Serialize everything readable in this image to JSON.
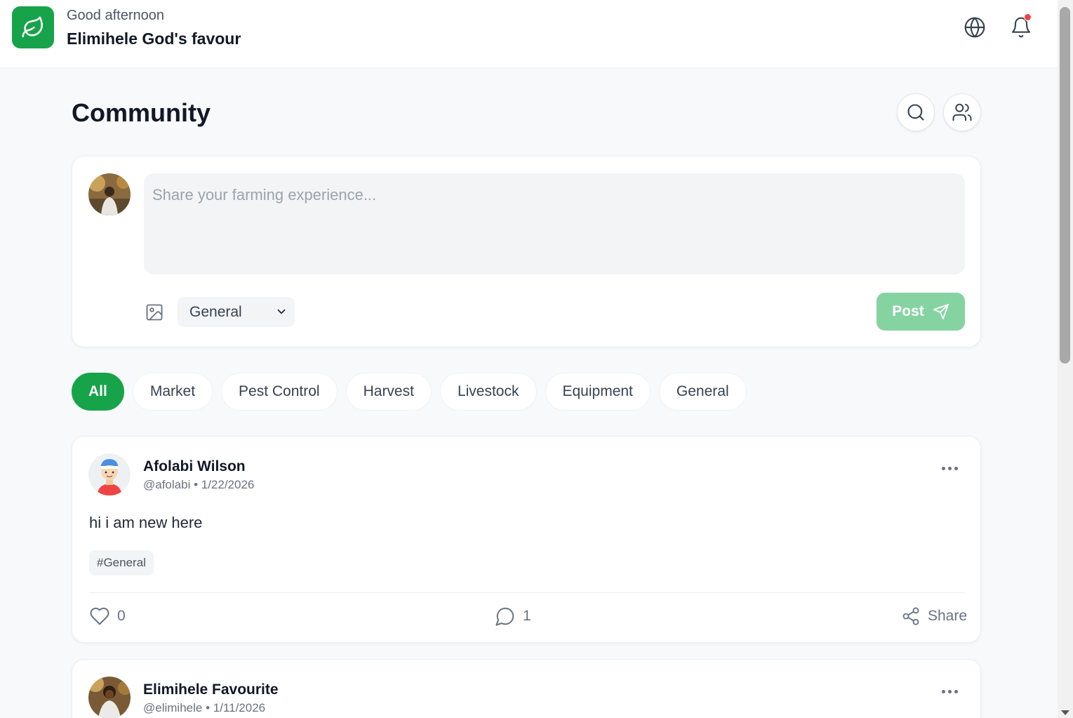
{
  "header": {
    "greeting": "Good afternoon",
    "user_name": "Elimihele God's favour"
  },
  "page": {
    "title": "Community"
  },
  "composer": {
    "placeholder": "Share your farming experience...",
    "category": "General",
    "post_label": "Post"
  },
  "filters": [
    {
      "label": "All",
      "active": true
    },
    {
      "label": "Market"
    },
    {
      "label": "Pest Control"
    },
    {
      "label": "Harvest"
    },
    {
      "label": "Livestock"
    },
    {
      "label": "Equipment"
    },
    {
      "label": "General"
    }
  ],
  "posts": [
    {
      "author": "Afolabi Wilson",
      "meta": "@afolabi • 1/22/2026",
      "body": "hi i am new here",
      "tag": "#General",
      "likes": "0",
      "comments": "1",
      "share_label": "Share"
    },
    {
      "author": "Elimihele Favourite",
      "meta": "@elimihele • 1/11/2026"
    }
  ],
  "colors": {
    "brand_green": "#16a34a",
    "post_button_disabled": "#86d3a2",
    "notification_dot": "#ef4444",
    "page_background": "#f8f9fa"
  }
}
